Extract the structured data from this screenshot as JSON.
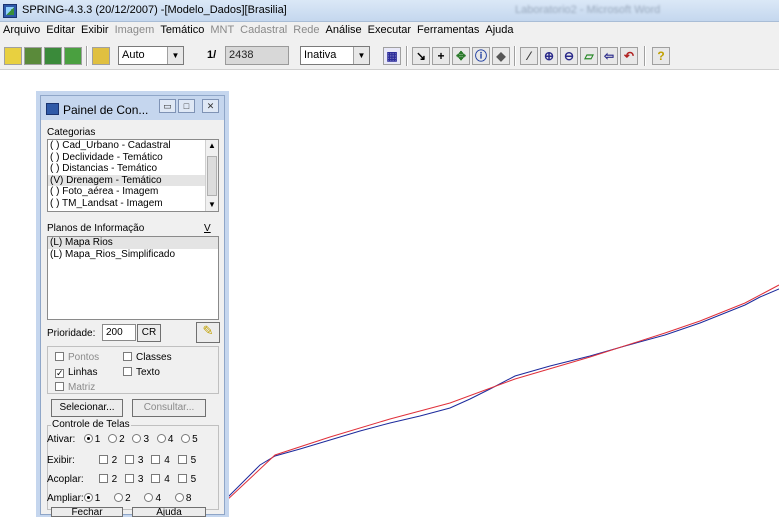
{
  "window": {
    "title": "SPRING-4.3.3 (20/12/2007) -[Modelo_Dados][Brasilia]",
    "title_extra": "Laboratorio2 - Microsoft Word"
  },
  "menu": [
    "Arquivo",
    "Editar",
    "Exibir",
    "Imagem",
    "Temático",
    "MNT",
    "Cadastral",
    "Rede",
    "Análise",
    "Executar",
    "Ferramentas",
    "Ajuda"
  ],
  "menu_disabled": [
    "Imagem",
    "MNT",
    "Cadastral",
    "Rede"
  ],
  "toolbar": {
    "zoom_mode": "Auto",
    "scale_prefix": "1/",
    "scale_value": "2438",
    "mode_select": "Inativa",
    "help_icon": "?"
  },
  "panel": {
    "title": "Painel de Con...",
    "categories_label": "Categorias",
    "categories": [
      "( ) Cad_Urbano - Cadastral",
      "( ) Declividade - Temático",
      "( ) Distancias - Temático",
      "(V) Drenagem - Temático",
      "( ) Foto_aérea - Imagem",
      "( ) TM_Landsat - Imagem"
    ],
    "selected_category_index": 3,
    "planos_label": "Planos de Informação",
    "planos_v": "V",
    "planos": [
      "(L) Mapa Rios",
      "(L) Mapa_Rios_Simplificado"
    ],
    "prioridade_label": "Prioridade:",
    "prioridade_value": "200",
    "cr_button": "CR",
    "checks": {
      "pontos": "Pontos",
      "classes": "Classes",
      "linhas": "Linhas",
      "texto": "Texto",
      "matriz": "Matriz"
    },
    "selecionar": "Selecionar...",
    "consultar": "Consultar...",
    "controle_label": "Controle de Telas",
    "ativar_label": "Ativar:",
    "exibir_label": "Exibir:",
    "acoplar_label": "Acoplar:",
    "ampliar_label": "Ampliar:",
    "screens": [
      "1",
      "2",
      "3",
      "4",
      "5"
    ],
    "ampliar_opts": [
      "1",
      "2",
      "4",
      "8"
    ],
    "fechar": "Fechar",
    "ajuda": "Ajuda"
  },
  "colors": {
    "river_blue": "#1c2a9c",
    "river_red": "#e0303a",
    "title_bg": "#c4d7ee"
  }
}
